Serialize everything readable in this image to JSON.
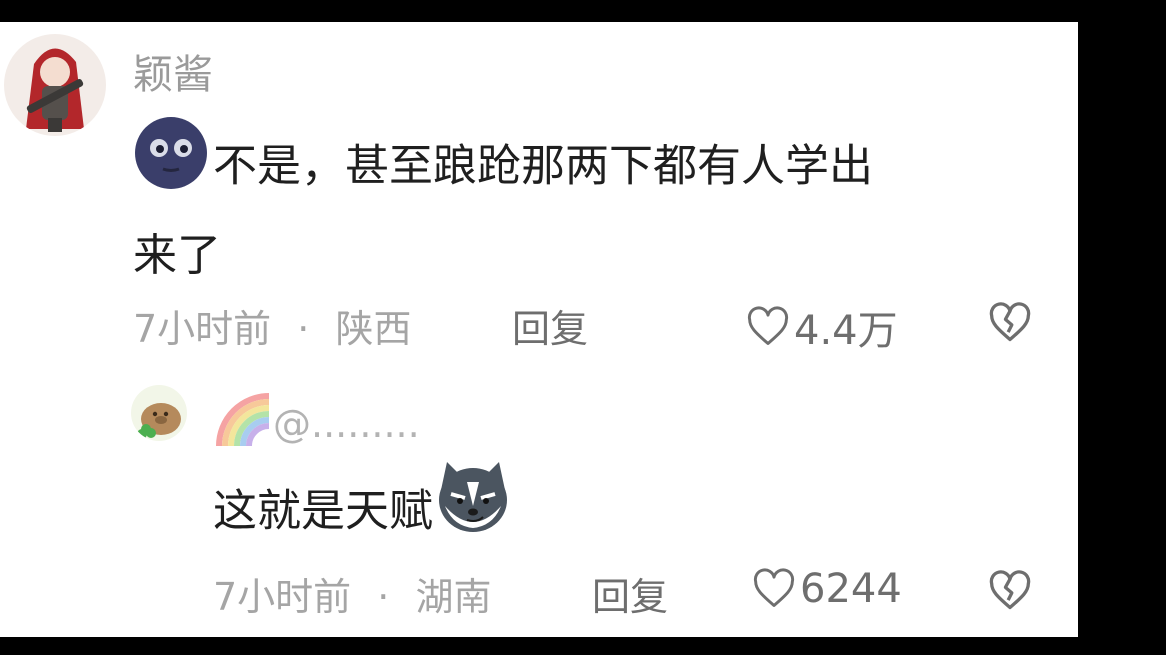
{
  "comment": {
    "username": "颖酱",
    "text_line1": "不是，甚至踉跄那两下都有人学出",
    "text_line2": "来了",
    "emoji_before": "moon-face-emoji",
    "time": "7小时前",
    "separator": "·",
    "location": "陕西",
    "reply_label": "回复",
    "likes": "4.4万"
  },
  "reply": {
    "username": "@.........",
    "username_prefix_icon": "rainbow-icon",
    "text": "这就是天赋",
    "emoji_after": "husky-smirk-emoji",
    "time": "7小时前",
    "separator": "·",
    "location": "湖南",
    "reply_label": "回复",
    "likes": "6244"
  },
  "colors": {
    "background": "#ffffff",
    "frame": "#000000",
    "text": "#1f1f1f",
    "muted": "#a5a5a5"
  }
}
